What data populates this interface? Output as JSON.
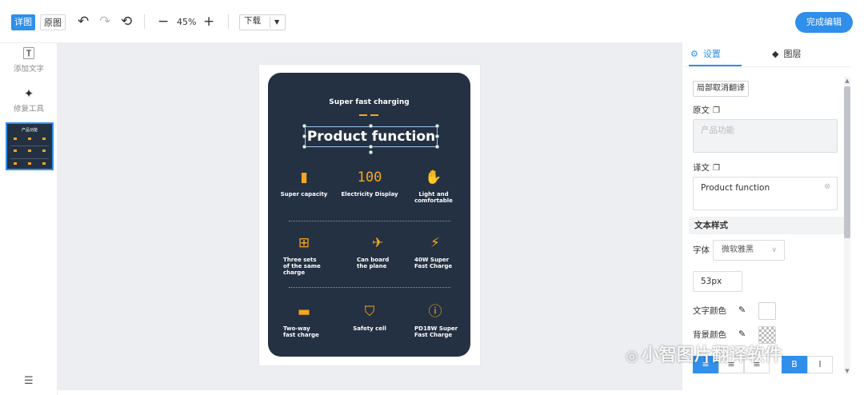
{
  "toolbar": {
    "mode_detail": "详图",
    "mode_original": "原图",
    "zoom": "45%",
    "download": "下载",
    "finish": "完成编辑"
  },
  "left_tools": [
    {
      "label": "添加文字",
      "icon": "text-tool-icon"
    },
    {
      "label": "修复工具",
      "icon": "magic-wand-icon"
    }
  ],
  "thumbnail": {
    "title": "产品功能"
  },
  "poster": {
    "subtitle": "Super fast charging",
    "title": "Product function",
    "features": [
      {
        "label": "Super capacity",
        "icon": "battery-icon"
      },
      {
        "label": "Electricity Display",
        "icon": "digital-display-icon"
      },
      {
        "label": "Light and comfortable",
        "icon": "hand-icon"
      },
      {
        "label": "Three sets\nof the same\ncharge",
        "icon": "network-icon"
      },
      {
        "label": "Can board\nthe plane",
        "icon": "airplane-icon"
      },
      {
        "label": "40W Super\nFast Charge",
        "icon": "lightning-icon"
      },
      {
        "label": "Two-way\nfast charge",
        "icon": "charge-battery-icon"
      },
      {
        "label": "Safety cell",
        "icon": "shield-icon"
      },
      {
        "label": "PD18W Super\nFast Charge",
        "icon": "bolt-circle-icon"
      }
    ]
  },
  "panel": {
    "tab_settings": "设置",
    "tab_layers": "图层",
    "partial_cancel": "局部取消翻译",
    "original_label": "原文",
    "original_text": "产品功能",
    "translation_label": "译文",
    "translation_text": "Product function",
    "text_style": "文本样式",
    "font_label": "字体",
    "font_value": "微软雅黑",
    "font_size": "53px",
    "text_color_label": "文字颜色",
    "bg_color_label": "背景颜色"
  },
  "watermark": "小智图片翻译软件",
  "colors": {
    "accent": "#2f8fea",
    "card_bg": "#243142",
    "icon_orange": "#f5a623"
  }
}
